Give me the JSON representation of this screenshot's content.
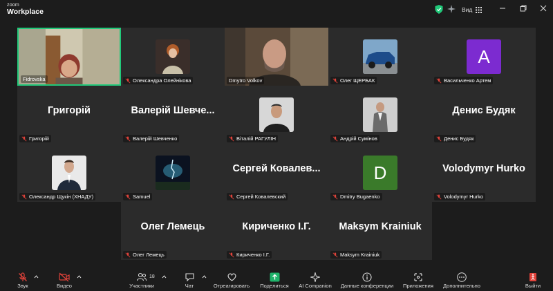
{
  "app": {
    "logo_small": "zoom",
    "logo_big": "Workplace",
    "view_label": "Вид"
  },
  "tiles": [
    {
      "name": "Fidrovska",
      "type": "video",
      "active": true,
      "muted": false
    },
    {
      "name": "Олександра Олейнікова",
      "type": "avatar",
      "muted": true
    },
    {
      "name": "Dmytro Volkov",
      "type": "video",
      "muted": false
    },
    {
      "name": "Олег ЩЕРБАК",
      "type": "avatar",
      "muted": true
    },
    {
      "name": "Васильченко Артем",
      "type": "letter",
      "letter": "A",
      "color": "#7c2bd0",
      "muted": true
    },
    {
      "name": "Григорій",
      "big": "Григорій",
      "type": "text",
      "muted": true
    },
    {
      "name": "Валерій Шевченко",
      "big": "Валерій Шевче...",
      "type": "text",
      "muted": true
    },
    {
      "name": "Віталій РАГУЛІН",
      "type": "avatar",
      "muted": true
    },
    {
      "name": "Андрій Сумінов",
      "type": "avatar",
      "muted": true
    },
    {
      "name": "Денис Будяк",
      "big": "Денис Будяк",
      "type": "text",
      "muted": true
    },
    {
      "name": "Олександр Щукін (ХНАДУ)",
      "type": "avatar",
      "muted": true
    },
    {
      "name": "Samuel",
      "type": "avatar",
      "muted": true
    },
    {
      "name": "Сергей Ковалевский",
      "big": "Сергей Ковалев...",
      "type": "text",
      "muted": true
    },
    {
      "name": "Dmitry Bugaenko",
      "type": "letter",
      "letter": "D",
      "color": "#3a7a2a",
      "muted": true
    },
    {
      "name": "Volodymyr Hurko",
      "big": "Volodymyr Hurko",
      "type": "text",
      "muted": true
    },
    {
      "name": "Олег Лемець",
      "big": "Олег Лемець",
      "type": "text",
      "muted": true
    },
    {
      "name": "Кириченко І.Г.",
      "big": "Кириченко І.Г.",
      "type": "text",
      "muted": true
    },
    {
      "name": "Maksym Krainiuk",
      "big": "Maksym Krainiuk",
      "type": "text",
      "muted": true
    }
  ],
  "toolbar": {
    "audio": "Звук",
    "video": "Видео",
    "participants": "Участники",
    "participants_count": "18",
    "chat": "Чат",
    "react": "Отреагировать",
    "share": "Поделиться",
    "ai": "AI Companion",
    "info": "Данные конференции",
    "apps": "Приложения",
    "more": "Дополнительно",
    "leave": "Выйти"
  },
  "colors": {
    "accent_green": "#21c97a",
    "share_green": "#1fb36a",
    "mute_red": "#e0423a",
    "tile_bg": "#2b2b2b"
  }
}
